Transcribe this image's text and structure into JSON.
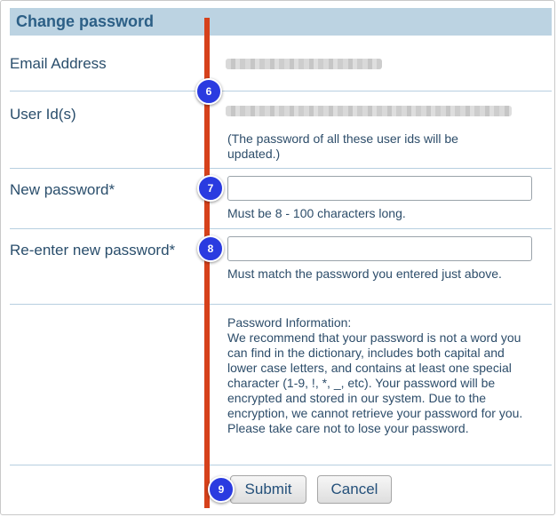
{
  "form": {
    "title": "Change password",
    "email_label": "Email Address",
    "userid_label": "User Id(s)",
    "userid_note": "(The password of all these user ids will be updated.)",
    "new_password_label": "New password*",
    "new_password_hint": "Must be 8 - 100 characters long.",
    "reenter_label": "Re-enter new password*",
    "reenter_hint": "Must match the password you entered just above.",
    "info_text": "Password Information:\nWe recommend that your password is not a word you can find in the dictionary, includes both capital and lower case letters, and contains at least one special character (1-9, !, *, _, etc). Your password will be encrypted and stored in our system. Due to the encryption, we cannot retrieve your password for you. Please take care not to lose your password.",
    "submit_label": "Submit",
    "cancel_label": "Cancel"
  },
  "annotations": {
    "steps": [
      "6",
      "7",
      "8",
      "9"
    ],
    "line_color": "#d6411b",
    "badge_color": "#2a3be0"
  }
}
